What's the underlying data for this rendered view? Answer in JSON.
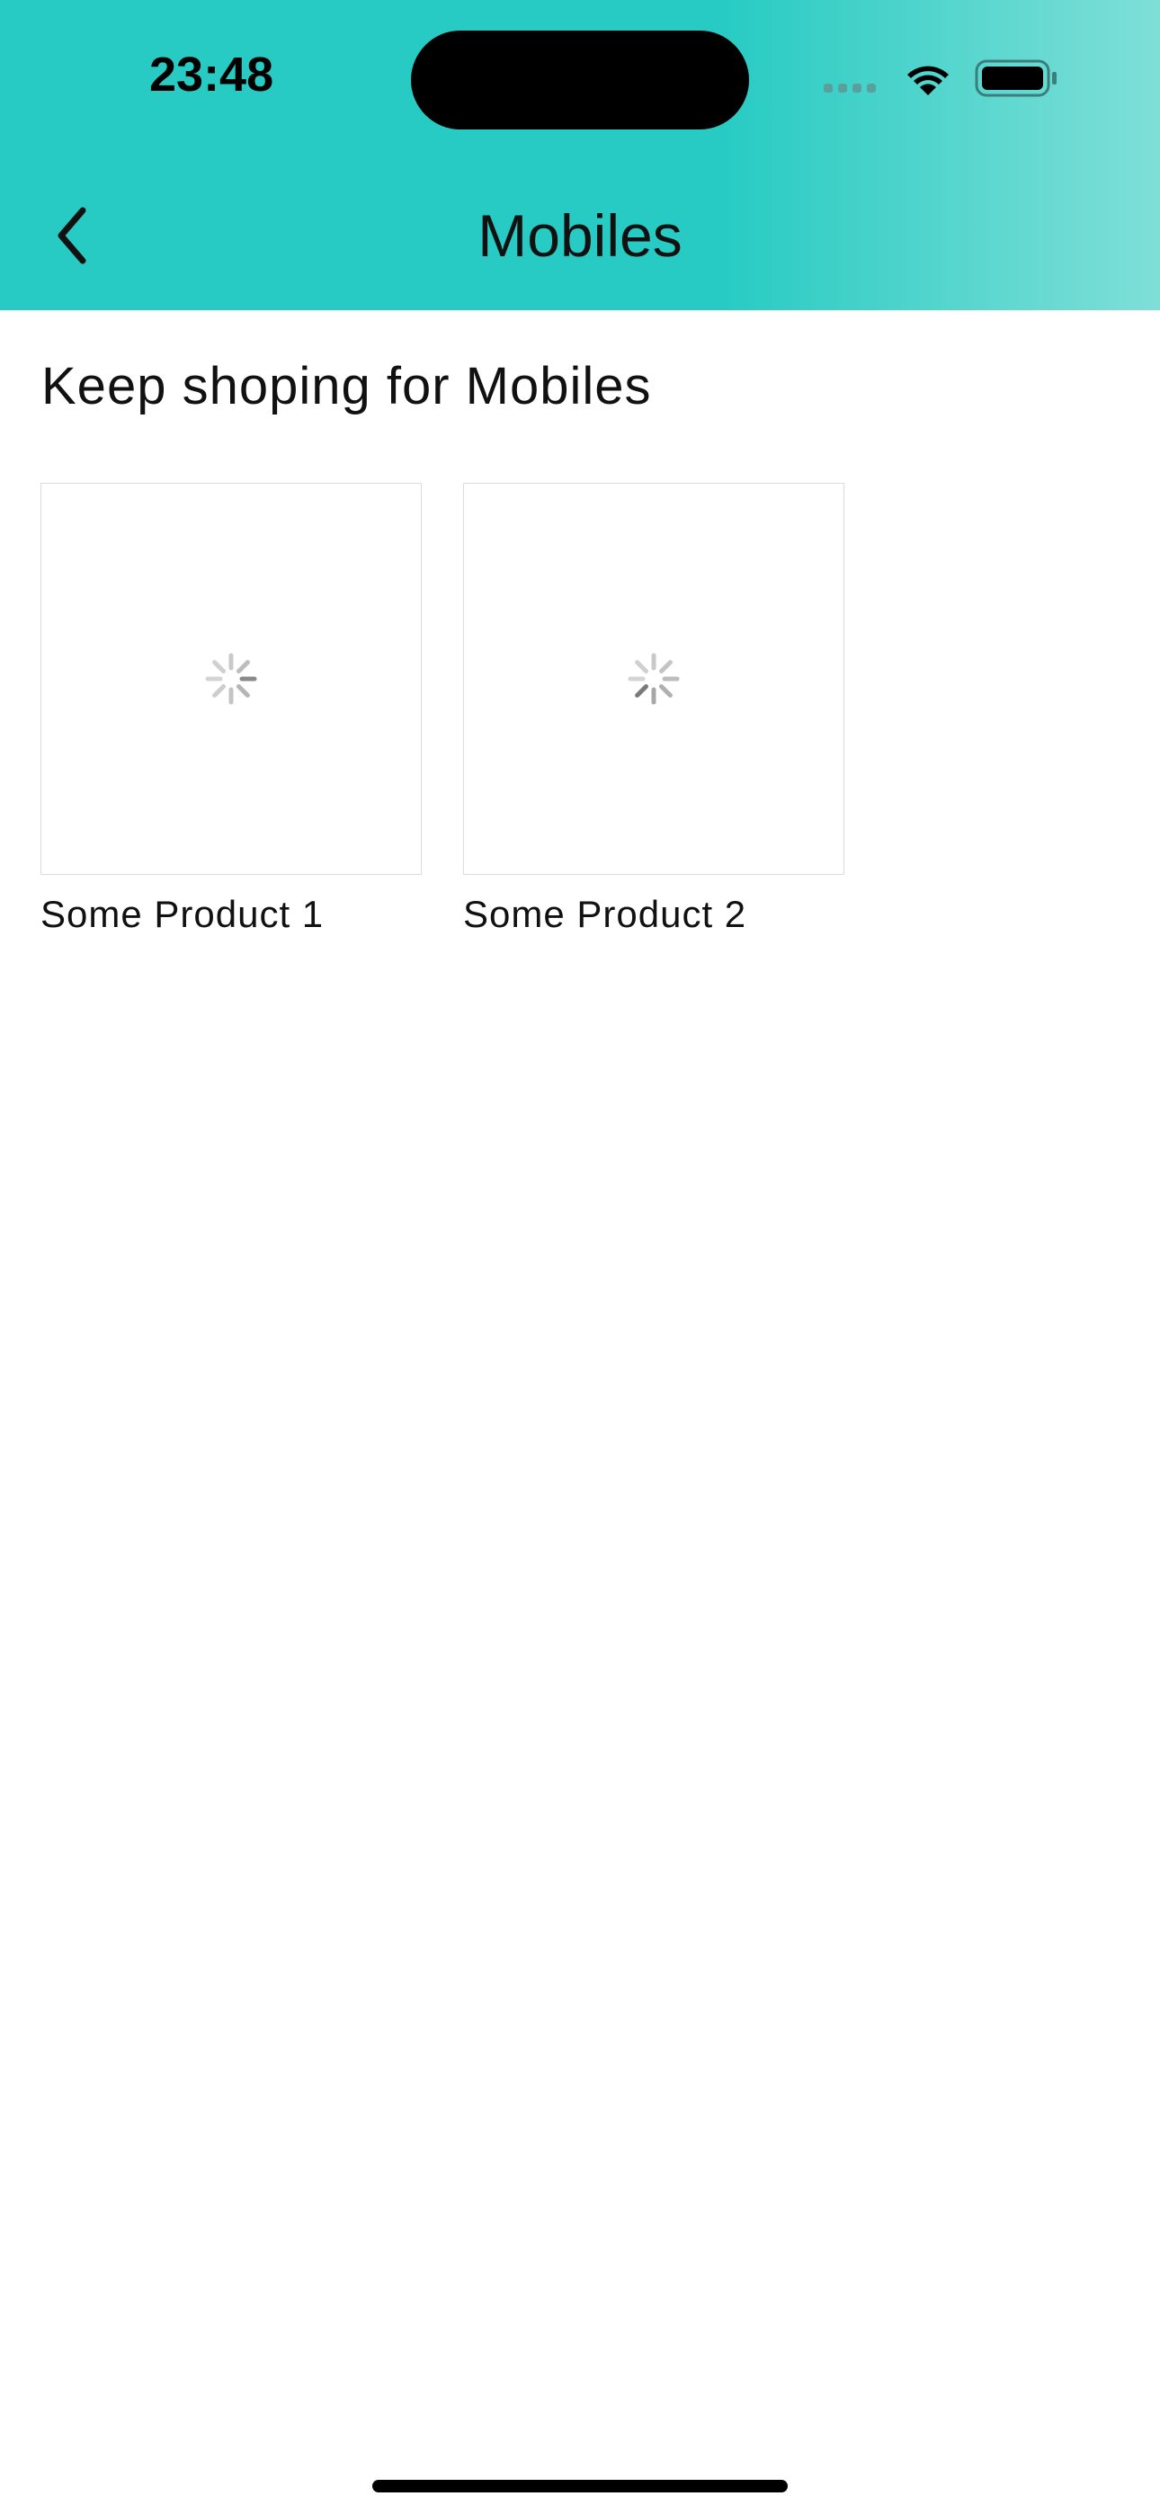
{
  "status_bar": {
    "time": "23:48",
    "icons": [
      "signal-icon",
      "wifi-icon",
      "battery-icon"
    ]
  },
  "header": {
    "title": "Mobiles",
    "back_icon": "chevron-left-icon",
    "gradient_colors": [
      "#27cbc3",
      "#7fdfd7"
    ]
  },
  "main": {
    "section_title": "Keep shoping for Mobiles",
    "products": [
      {
        "label": "Some Product 1",
        "image_state": "loading"
      },
      {
        "label": "Some Product 2",
        "image_state": "loading"
      }
    ]
  }
}
